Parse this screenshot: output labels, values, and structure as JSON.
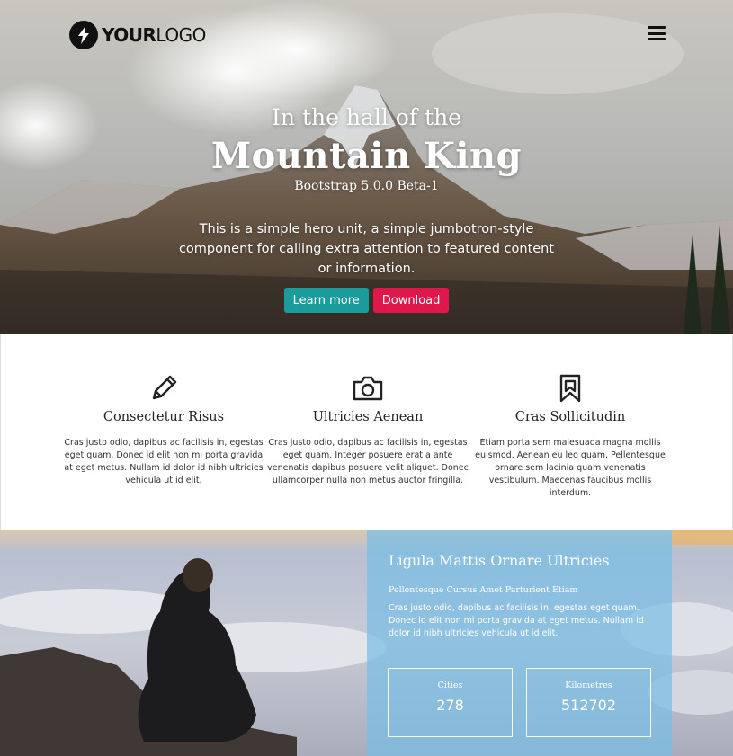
{
  "header": {
    "logo_bold": "YOUR",
    "logo_light": "LOGO",
    "logo_icon": "lightning-bolt-icon",
    "menu_icon": "hamburger-menu-icon"
  },
  "hero": {
    "subtitle": "In the hall of the",
    "title": "Mountain King",
    "version": "Bootstrap 5.0.0 Beta-1",
    "lead": "This is a simple hero unit, a simple jumbotron-style component for calling extra attention to featured content or information.",
    "learn_more_label": "Learn more",
    "download_label": "Download"
  },
  "features": [
    {
      "icon": "pencil-icon",
      "title": "Consectetur Risus",
      "text": "Cras justo odio, dapibus ac facilisis in, egestas eget quam. Donec id elit non mi porta gravida at eget metus. Nullam id dolor id nibh ultricies vehicula ut id elit."
    },
    {
      "icon": "camera-icon",
      "title": "Ultricies Aenean",
      "text": "Cras justo odio, dapibus ac facilisis in, egestas eget quam. Integer posuere erat a ante venenatis dapibus posuere velit aliquet. Donec ullamcorper nulla non metus auctor fringilla."
    },
    {
      "icon": "bookmark-icon",
      "title": "Cras Sollicitudin",
      "text": "Etiam porta sem malesuada magna mollis euismod. Aenean eu leo quam. Pellentesque ornare sem lacinia quam venenatis vestibulum. Maecenas faucibus mollis interdum."
    }
  ],
  "panel": {
    "title": "Ligula Mattis Ornare Ultricies",
    "subtitle": "Pellentesque Cursus Amet Parturient Etiam",
    "text": "Cras justo odio, dapibus ac facilisis in, egestas eget quam. Donec id elit non mi porta gravida at eget metus. Nullam id dolor id nibh ultricies vehicula ut id elit.",
    "stats": [
      {
        "label": "Cities",
        "value": "278"
      },
      {
        "label": "Kilometres",
        "value": "512702"
      }
    ]
  },
  "colors": {
    "learn_more": "#1a9c9c",
    "download": "#e0174c",
    "panel": "#78bee4"
  }
}
